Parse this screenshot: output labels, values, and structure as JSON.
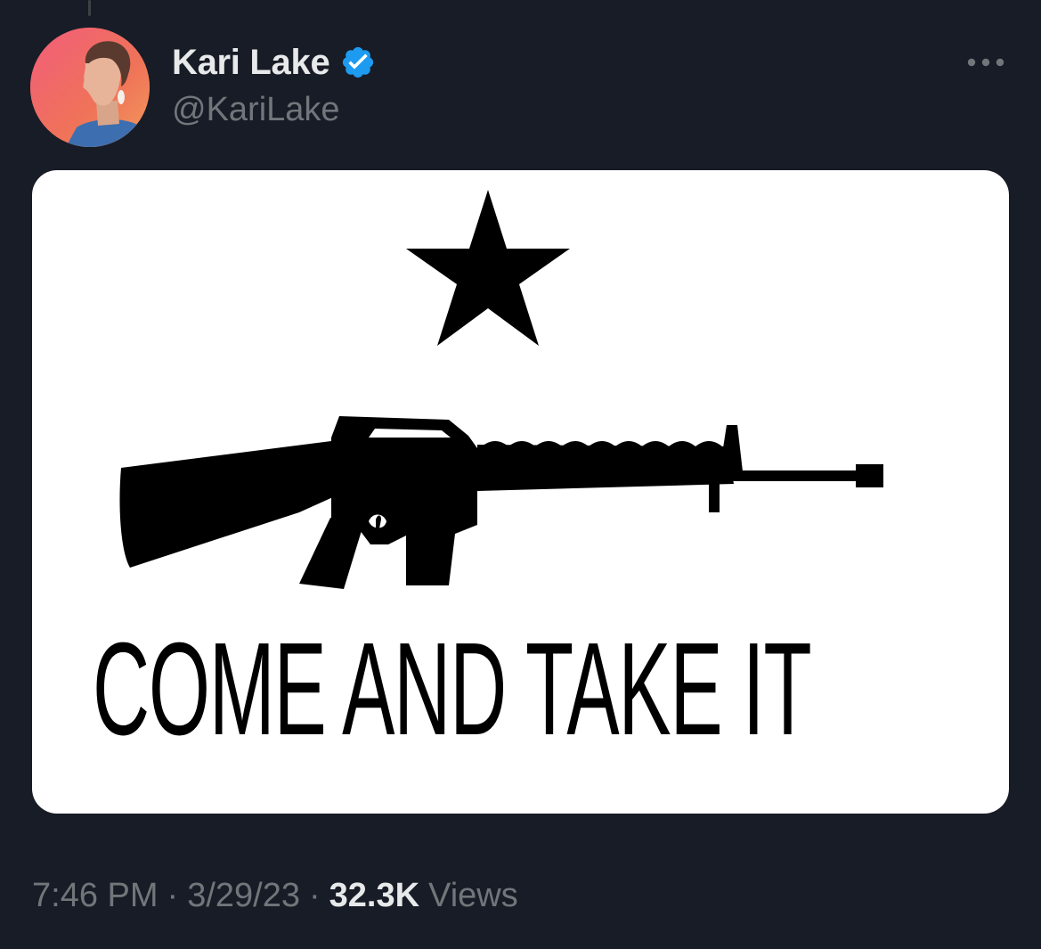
{
  "tweet": {
    "author": {
      "display_name": "Kari Lake",
      "handle": "@KariLake",
      "verified": true,
      "avatar_icon": "profile-photo"
    },
    "more_icon": "ellipsis-icon",
    "media": {
      "flag_text": "COME AND TAKE IT",
      "colors": {
        "background": "#ffffff",
        "foreground": "#000000"
      }
    },
    "time": "7:46 PM",
    "separator": "·",
    "date": "3/29/23",
    "views_count": "32.3K",
    "views_label": "Views"
  },
  "colors": {
    "page_background": "#181c26",
    "primary_text": "#e7e9ea",
    "secondary_text": "#71767b",
    "verified_badge": "#1d9bf0"
  }
}
